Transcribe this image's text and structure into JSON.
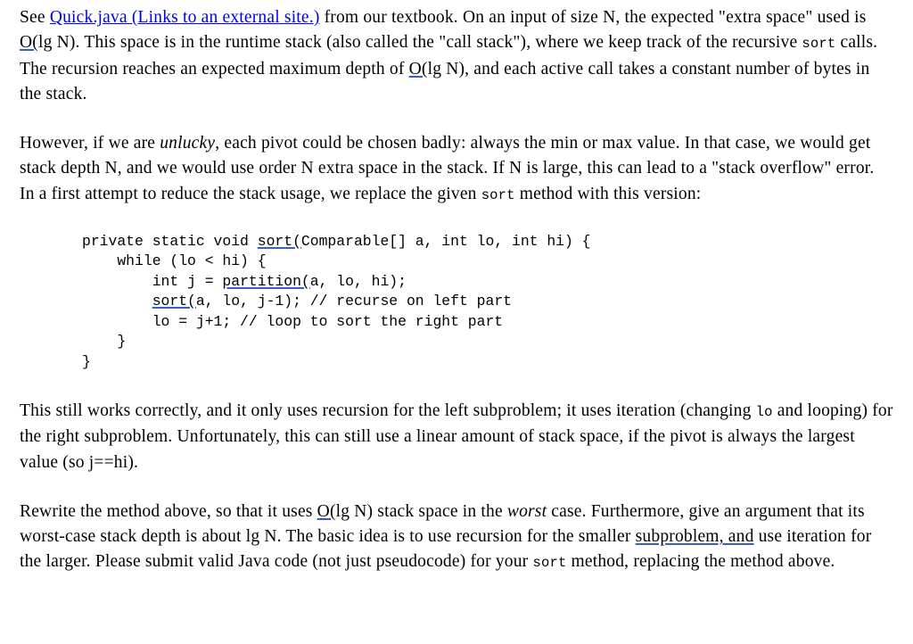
{
  "document": {
    "background_color": "#ffffff",
    "text_color": "#000000",
    "link_color": "#0000ee",
    "spellcheck_underline_color": "#3b5ccc"
  },
  "paragraph1": {
    "seg_see": "See ",
    "link_label": "Quick.java (Links to an external site.)",
    "seg_after_link": " from our textbook. On an input of size N, the expected \"extra space\" used is ",
    "bigo_open": "O(",
    "seg_lgn_1": "lg N).  This space is in the runtime stack (also called the \"call stack\"), where we keep track of the recursive ",
    "code_sort_1": "sort",
    "seg_after_sort": " calls. The recursion reaches an expected maximum depth of ",
    "bigo_open_2": "O(",
    "seg_end": "lg N), and each active call takes a constant number of bytes in the stack."
  },
  "paragraph2": {
    "seg_start": "However, if we are ",
    "italic_unlucky": "unlucky",
    "seg_middle": ", each pivot could be chosen badly: always the min or max value. In that case, we would get stack depth N, and we would use order N extra space in the stack.  If N is large, this can lead to a \"stack overflow\" error.  In a first attempt to reduce the stack usage, we replace the given ",
    "code_sort": "sort",
    "seg_end": " method with this version:"
  },
  "code_block": {
    "line1_pre": "private static void ",
    "line1_link": "sort(",
    "line1_post": "Comparable[] a, int lo, int hi) {",
    "line2": "    while (lo < hi) {",
    "line3_pre": "        int j = ",
    "line3_link": "partition(",
    "line3_post": "a, lo, hi);",
    "line4_pre": "        ",
    "line4_link": "sort(",
    "line4_post": "a, lo, j-1); // recurse on left part",
    "line5": "        lo = j+1; // loop to sort the right part",
    "line6": "    }",
    "line7": "}"
  },
  "paragraph3": {
    "seg_start": "This still works correctly, and it only uses recursion for the left subproblem; it uses iteration (changing ",
    "code_lo": "lo",
    "seg_end": " and looping) for the right subproblem. Unfortunately, this can still use a linear amount of stack space, if the pivot is always the largest value (so j==hi)."
  },
  "paragraph4": {
    "seg_start": "Rewrite the method above, so that it uses ",
    "bigo_open": "O(",
    "seg_mid1": "lg N) stack space in the ",
    "italic_worst": "worst",
    "seg_mid2": " case.  Furthermore, give an argument that its worst-case stack depth is about lg N.  The basic idea is to use recursion for the smaller ",
    "underlined_phrase": "subproblem, and",
    "seg_mid3": " use iteration for the larger. Please submit valid Java code (not just pseudocode) for your ",
    "code_sort": "sort",
    "seg_end": " method, replacing the method above."
  }
}
